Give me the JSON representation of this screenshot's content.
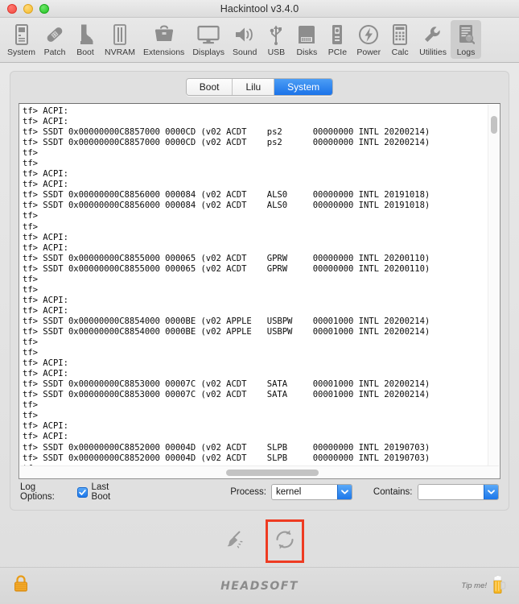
{
  "window": {
    "title": "Hackintool v3.4.0",
    "traffic_lights": [
      "close",
      "minimize",
      "zoom"
    ]
  },
  "toolbar": {
    "items": [
      {
        "label": "System",
        "icon": "computer-tower-icon"
      },
      {
        "label": "Patch",
        "icon": "bandage-icon"
      },
      {
        "label": "Boot",
        "icon": "boot-icon"
      },
      {
        "label": "NVRAM",
        "icon": "memory-chip-icon"
      },
      {
        "label": "Extensions",
        "icon": "toolbox-icon"
      },
      {
        "label": "Displays",
        "icon": "monitor-icon"
      },
      {
        "label": "Sound",
        "icon": "speaker-icon"
      },
      {
        "label": "USB",
        "icon": "usb-icon"
      },
      {
        "label": "Disks",
        "icon": "harddisk-icon"
      },
      {
        "label": "PCIe",
        "icon": "pcie-card-icon"
      },
      {
        "label": "Power",
        "icon": "power-bolt-icon"
      },
      {
        "label": "Calc",
        "icon": "calculator-icon"
      },
      {
        "label": "Utilities",
        "icon": "wrench-icon"
      },
      {
        "label": "Logs",
        "icon": "log-search-icon"
      }
    ],
    "active_index": 13
  },
  "tabs": {
    "items": [
      "Boot",
      "Lilu",
      "System"
    ],
    "selected": "System",
    "accent": "#1b73e8"
  },
  "log": {
    "lines": [
      "tf> ACPI:",
      "tf> ACPI:",
      "tf> SSDT 0x00000000C8857000 0000CD (v02 ACDT    ps2      00000000 INTL 20200214)",
      "tf> SSDT 0x00000000C8857000 0000CD (v02 ACDT    ps2      00000000 INTL 20200214)",
      "tf>",
      "tf>",
      "tf> ACPI:",
      "tf> ACPI:",
      "tf> SSDT 0x00000000C8856000 000084 (v02 ACDT    ALS0     00000000 INTL 20191018)",
      "tf> SSDT 0x00000000C8856000 000084 (v02 ACDT    ALS0     00000000 INTL 20191018)",
      "tf>",
      "tf>",
      "tf> ACPI:",
      "tf> ACPI:",
      "tf> SSDT 0x00000000C8855000 000065 (v02 ACDT    GPRW     00000000 INTL 20200110)",
      "tf> SSDT 0x00000000C8855000 000065 (v02 ACDT    GPRW     00000000 INTL 20200110)",
      "tf>",
      "tf>",
      "tf> ACPI:",
      "tf> ACPI:",
      "tf> SSDT 0x00000000C8854000 0000BE (v02 APPLE   USBPW    00001000 INTL 20200214)",
      "tf> SSDT 0x00000000C8854000 0000BE (v02 APPLE   USBPW    00001000 INTL 20200214)",
      "tf>",
      "tf>",
      "tf> ACPI:",
      "tf> ACPI:",
      "tf> SSDT 0x00000000C8853000 00007C (v02 ACDT    SATA     00001000 INTL 20200214)",
      "tf> SSDT 0x00000000C8853000 00007C (v02 ACDT    SATA     00001000 INTL 20200214)",
      "tf>",
      "tf>",
      "tf> ACPI:",
      "tf> ACPI:",
      "tf> SSDT 0x00000000C8852000 00004D (v02 ACDT    SLPB     00000000 INTL 20190703)",
      "tf> SSDT 0x00000000C8852000 00004D (v02 ACDT    SLPB     00000000 INTL 20190703)",
      "tf>"
    ]
  },
  "options": {
    "log_options_label": "Log Options:",
    "last_boot_label": "Last Boot",
    "last_boot_checked": true,
    "process_label": "Process:",
    "process_value": "kernel",
    "contains_label": "Contains:",
    "contains_value": "",
    "contains_placeholder": ""
  },
  "actions": {
    "clear_icon": "broom-icon",
    "refresh_icon": "refresh-icon",
    "highlighted": "refresh-button",
    "highlight_color": "#ee3b22"
  },
  "footer": {
    "lock_icon": "lock-icon",
    "brand": "HEADSOFT",
    "tip_text": "Tip me!",
    "tip_icon": "beer-mug-icon"
  }
}
